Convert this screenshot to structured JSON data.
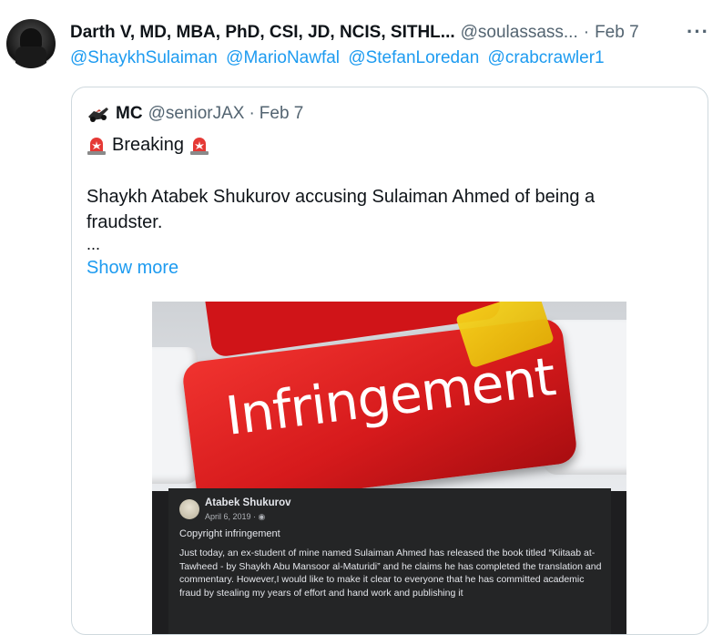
{
  "tweet": {
    "display_name": "Darth V, MD, MBA, PhD, CSI, JD, NCIS, SITHL...",
    "handle": "@soulassass...",
    "separator": "·",
    "date": "Feb 7",
    "more_icon": "···",
    "mentions": [
      "@ShaykhSulaiman",
      "@MarioNawfal",
      "@StefanLoredan",
      "@crabcrawler1"
    ]
  },
  "quote": {
    "display_name": "MC",
    "handle": "@seniorJAX",
    "separator": "·",
    "date": "Feb 7",
    "headline": "Breaking",
    "body": "Shaykh Atabek Shukurov accusing Sulaiman Ahmed of being a fraudster.",
    "ellipsis": "...",
    "show_more": "Show more"
  },
  "media": {
    "key_text": "Infringement",
    "post_author": "Atabek Shukurov",
    "post_date": "April 6, 2019 · ",
    "post_title": "Copyright infringement",
    "post_text": "Just today, an ex-student of mine named Sulaiman Ahmed has released the book titled “Kiitaab at-Tawheed - by Shaykh Abu Mansoor al-Maturidi” and he claims he has completed the translation and commentary. However,I would like to make it clear to everyone that he has committed academic fraud by stealing my years of effort and hand work and publishing it"
  },
  "colors": {
    "link": "#1d9bf0",
    "muted": "#536471",
    "border": "#cfd9de",
    "key_red": "#d61a1c"
  }
}
